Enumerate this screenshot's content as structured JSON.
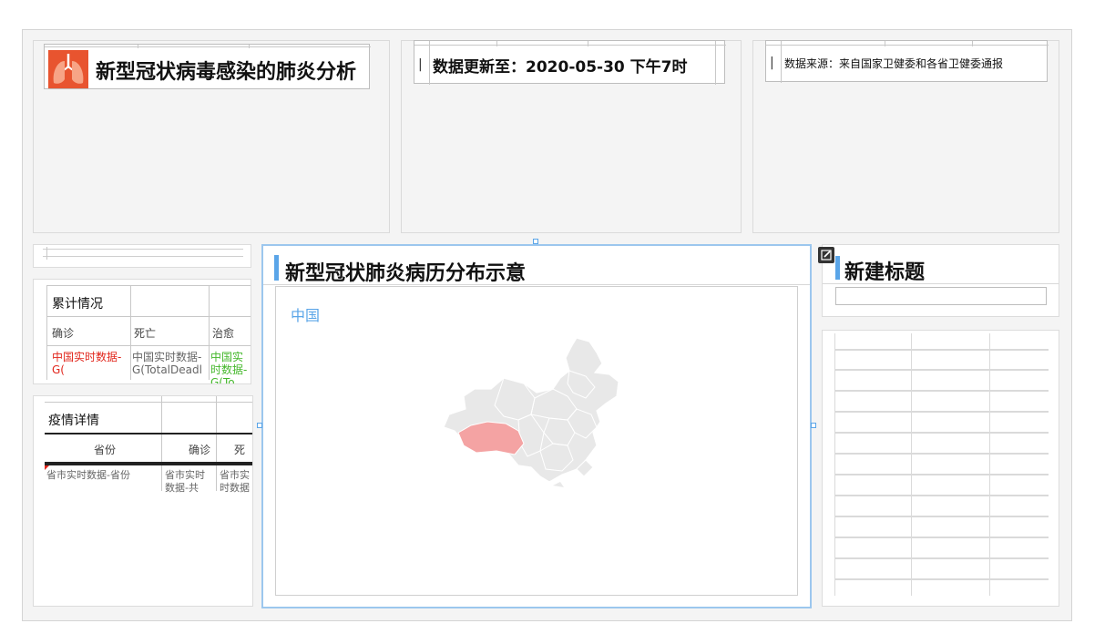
{
  "header": {
    "app_title": "新型冠状病毒感染的肺炎分析",
    "update_text": "数据更新至：2020-05-30 下午7时",
    "source_text": "数据来源：来自国家卫健委和各省卫健委通报",
    "separator": "|"
  },
  "summary": {
    "title": "累计情况",
    "columns": [
      "确诊",
      "死亡",
      "治愈"
    ],
    "values": [
      "中国实时数据-G(",
      "中国实时数据-G(TotalDeadl",
      "中国实时数据-G(To"
    ]
  },
  "detail": {
    "title": "疫情详情",
    "columns": [
      "省份",
      "确诊",
      "死"
    ],
    "row": [
      "省市实时数据-省份",
      "省市实时数据-共",
      "省市实时数据"
    ]
  },
  "map": {
    "title": "新型冠状肺炎病历分布示意",
    "label": "中国",
    "highlight_color": "#f4a3a3",
    "base_color": "#e8e8e8"
  },
  "right_panel": {
    "title": "新建标题",
    "edit_icon": "edit-icon"
  },
  "colors": {
    "accent": "#5aa5e8",
    "lung_icon": "#e8542f",
    "red_text": "#e1251b",
    "green_text": "#43b72a"
  }
}
